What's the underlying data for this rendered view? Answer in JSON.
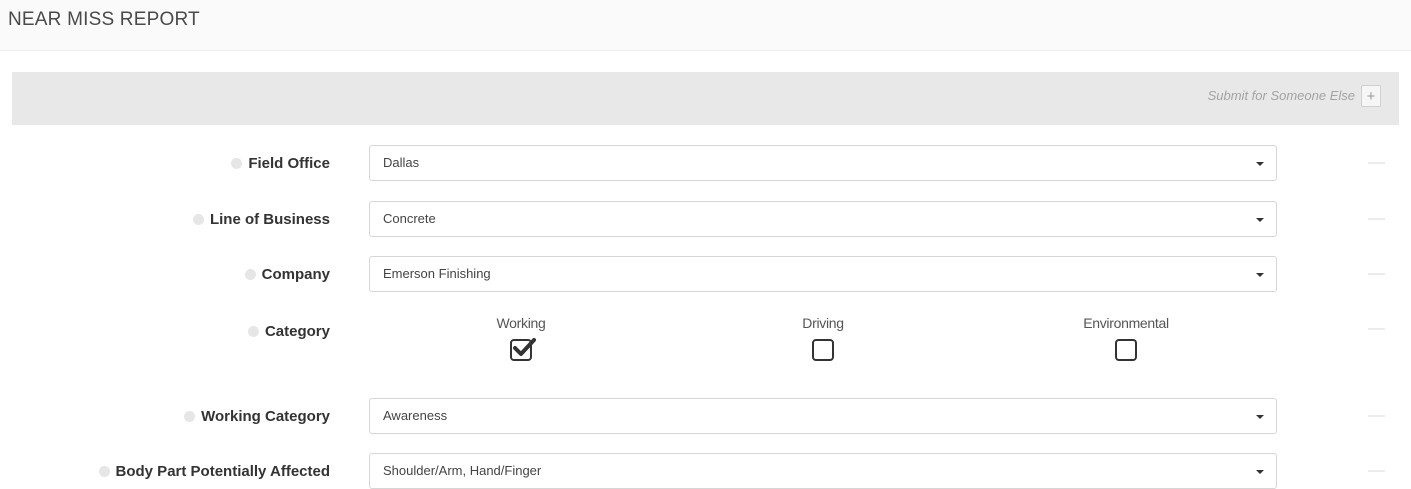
{
  "header": {
    "title": "NEAR MISS REPORT"
  },
  "submit_bar": {
    "label": "Submit for Someone Else",
    "button_icon": "plus-icon"
  },
  "fields": {
    "field_office": {
      "label": "Field Office",
      "value": "Dallas"
    },
    "line_of_business": {
      "label": "Line of Business",
      "value": "Concrete"
    },
    "company": {
      "label": "Company",
      "value": "Emerson Finishing"
    },
    "category": {
      "label": "Category",
      "options": [
        {
          "label": "Working",
          "checked": true
        },
        {
          "label": "Driving",
          "checked": false
        },
        {
          "label": "Environmental",
          "checked": false
        }
      ]
    },
    "working_category": {
      "label": "Working Category",
      "value": "Awareness"
    },
    "body_part": {
      "label": "Body Part Potentially Affected",
      "value": "Shoulder/Arm, Hand/Finger"
    }
  }
}
